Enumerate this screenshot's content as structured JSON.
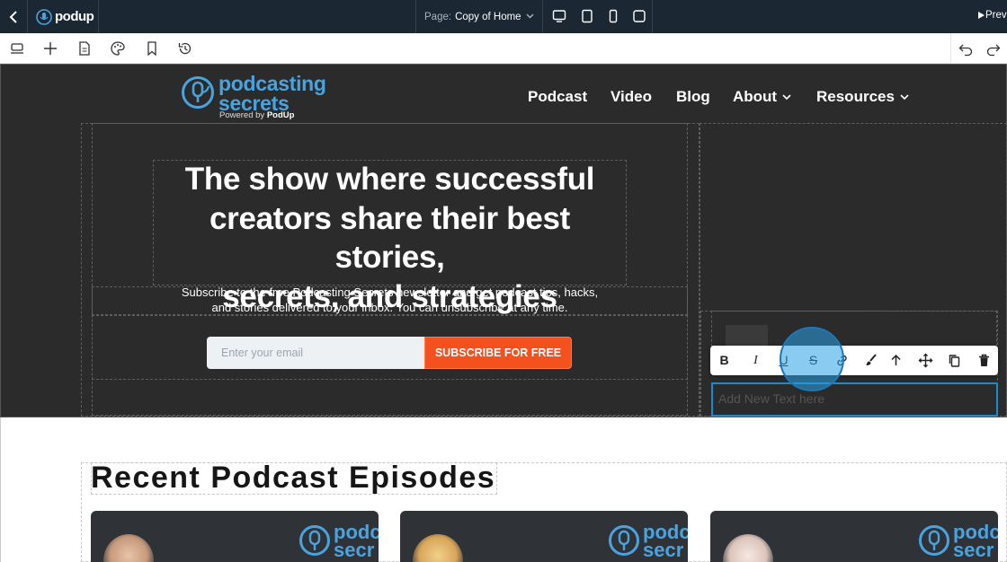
{
  "topbar": {
    "logo_text": "podup",
    "page_label": "Page:",
    "page_value": "Copy of Home",
    "preview_label": "Prev"
  },
  "site": {
    "logo_word": "podcasting",
    "logo_word2": "secrets",
    "powered_by": "Powered by",
    "powered_brand": "PodUp",
    "nav": [
      "Podcast",
      "Video",
      "Blog",
      "About",
      "Resources"
    ]
  },
  "hero": {
    "title_line1": "The show where successful",
    "title_line2": "creators share their best stories,",
    "title_line3": "secrets, and strategies",
    "subtitle_line1": "Subscribe to the free Podcasting Secrets newsletter and get podcast tips, hacks,",
    "subtitle_line2": "and stories delivered to your inbox. You can unsubscribe at any time.",
    "email_placeholder": "Enter your email",
    "subscribe_label": "SUBSCRIBE FOR FREE"
  },
  "text_toolbar": {
    "bold": "B",
    "italic": "I",
    "underline": "U",
    "strike": "S"
  },
  "editing_text": "Add New Text here",
  "recent": {
    "heading": "Recent Podcast Episodes",
    "card_logo": "podc",
    "card_logo2": "secr"
  },
  "colors": {
    "accent": "#f4511e",
    "topbar": "#1b2733",
    "hero_bg": "#2b2b2b",
    "logo_blue": "#4aa3de",
    "selection": "#1a8bd0"
  }
}
